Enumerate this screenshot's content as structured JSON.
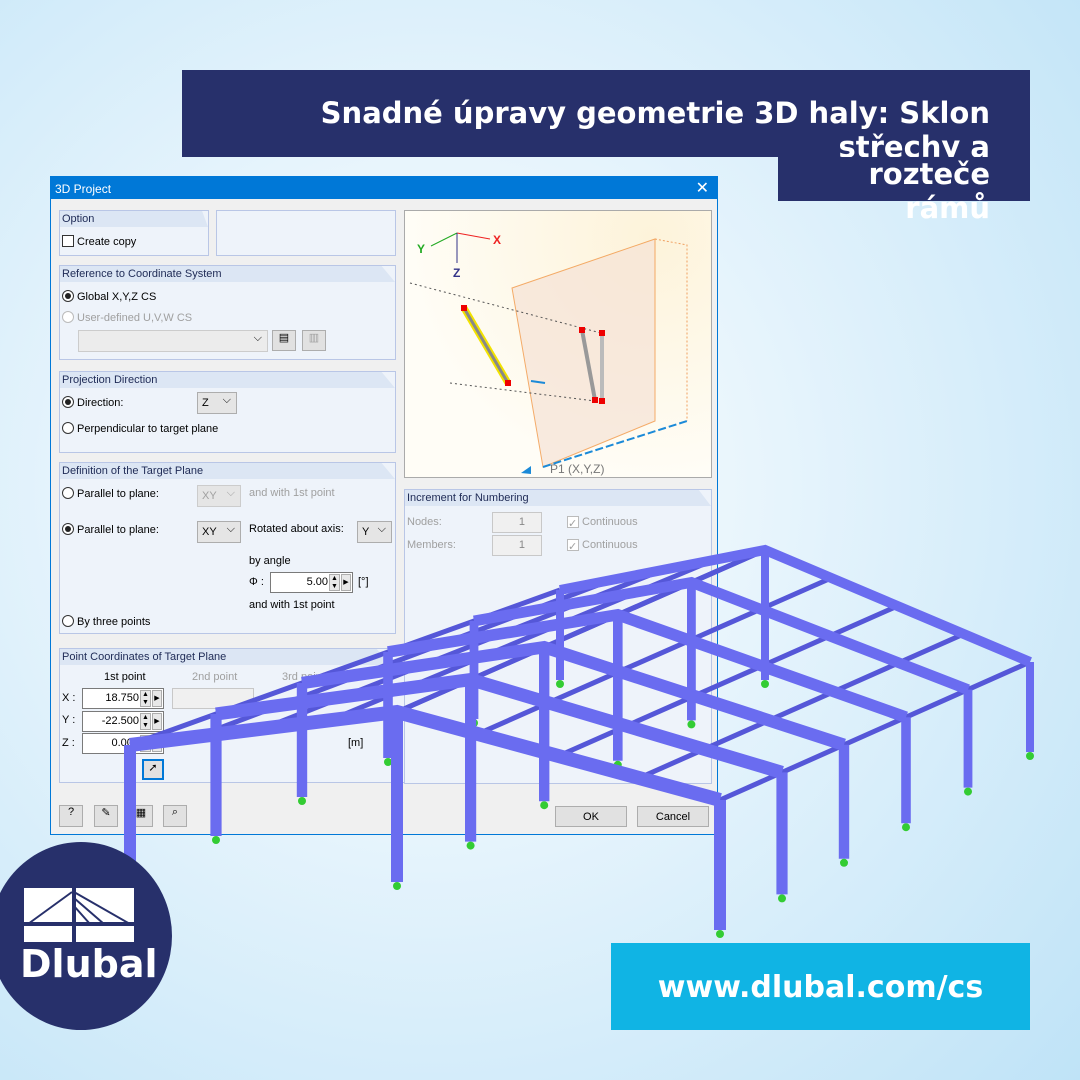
{
  "banner": {
    "line1": "Snadné úpravy geometrie 3D haly: Sklon střechy a",
    "line2": "rozteče rámů"
  },
  "dialog": {
    "title": "3D Project",
    "option": {
      "header": "Option",
      "create_copy": "Create copy",
      "create_copy_checked": false
    },
    "reference": {
      "header": "Reference to Coordinate System",
      "global": "Global X,Y,Z CS",
      "user": "User-defined U,V,W CS",
      "selected": "global"
    },
    "projection": {
      "header": "Projection Direction",
      "direction": "Direction:",
      "direction_value": "Z",
      "perpendicular": "Perpendicular to target plane",
      "selected": "direction"
    },
    "target": {
      "header": "Definition of the Target Plane",
      "parallel1": "Parallel to plane:",
      "parallel1_value": "XY",
      "and_first": "and with 1st point",
      "parallel2": "Parallel to plane:",
      "parallel2_value": "XY",
      "rotated": "Rotated about axis:",
      "axis_value": "Y",
      "by_angle": "by angle",
      "phi": "Φ :",
      "angle": "5.00",
      "angle_unit": "[°]",
      "and_first2": "and with 1st point",
      "three": "By three points",
      "selected": "parallel2"
    },
    "coords": {
      "header": "Point Coordinates of Target Plane",
      "p1": "1st point",
      "p2": "2nd point",
      "p3": "3rd point",
      "x_label": "X :",
      "y_label": "Y :",
      "z_label": "Z :",
      "x": "18.750",
      "y": "-22.500",
      "z": "0.000",
      "unit": "[m]"
    },
    "preview": {
      "x": "X",
      "y": "Y",
      "z": "Z",
      "p1": "P1 (X,Y,Z)"
    },
    "increment": {
      "header": "Increment for Numbering",
      "nodes": "Nodes:",
      "nodes_value": "1",
      "members": "Members:",
      "members_value": "1",
      "continuous": "Continuous"
    },
    "ok": "OK",
    "cancel": "Cancel"
  },
  "brand": {
    "name": "Dlubal",
    "url": "www.dlubal.com/cs"
  },
  "colors": {
    "navy": "#27306b",
    "cyan": "#10b4e4",
    "title_bar": "#0078d7",
    "steel": "#6a6cf0"
  }
}
